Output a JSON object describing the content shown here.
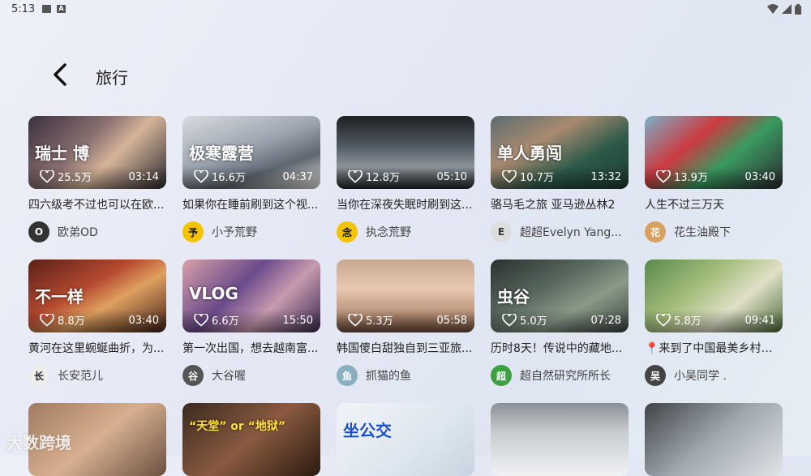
{
  "status_bar": {
    "time": "5:13"
  },
  "header": {
    "title": "旅行"
  },
  "videos": [
    {
      "likes": "25.5万",
      "duration": "03:14",
      "title": "四六级考不过也可以在欧...",
      "author": "欧弟OD",
      "overlay": "瑞士 博",
      "art": "linear-gradient(135deg,#3a3040 0%,#8a7070 40%,#d6b59a 60%,#2c2a30 100%)",
      "avatar_bg": "#333",
      "avatar_fg": "#fff",
      "avatar_text": "O"
    },
    {
      "likes": "16.6万",
      "duration": "04:37",
      "title": "如果你在睡前刷到这个视...",
      "author": "小予荒野",
      "overlay": "极寒露营",
      "art": "linear-gradient(160deg,#d8dbe0 0%,#9aa3ad 45%,#5e6670 70%,#e8e6e0 100%)",
      "avatar_bg": "#f5c400",
      "avatar_fg": "#111",
      "avatar_text": "予"
    },
    {
      "likes": "12.8万",
      "duration": "05:10",
      "title": "当你在深夜失眠时刷到这...",
      "author": "执念荒野",
      "overlay": "",
      "art": "linear-gradient(180deg,#1d2024 0%,#4f5860 40%,#8d969c 70%,#24282c 100%)",
      "avatar_bg": "#f5c400",
      "avatar_fg": "#111",
      "avatar_text": "念"
    },
    {
      "likes": "10.7万",
      "duration": "13:32",
      "title": "骆马毛之旅 亚马逊丛林2",
      "author": "超超Evelyn Yang...",
      "overlay": "单人勇闯",
      "art": "linear-gradient(150deg,#5b6c70 0%,#a88a70 35%,#2c5a48 65%,#1e3a2e 100%)",
      "avatar_bg": "#ddd",
      "avatar_fg": "#333",
      "avatar_text": "E"
    },
    {
      "likes": "13.9万",
      "duration": "03:40",
      "title": "人生不过三万天",
      "author": "花生油殿下",
      "overlay": "",
      "art": "linear-gradient(140deg,#7ab0c8 0%,#cc3a40 35%,#3a9a60 60%,#2a2a30 100%)",
      "avatar_bg": "#d9a060",
      "avatar_fg": "#fff",
      "avatar_text": "花"
    },
    {
      "likes": "8.8万",
      "duration": "03:40",
      "title": "黄河在这里蜿蜒曲折，为...",
      "author": "长安范儿",
      "overlay": "不一样",
      "art": "linear-gradient(150deg,#5a2018 0%,#b54a30 40%,#e0a060 60%,#402018 100%)",
      "avatar_bg": "#eee",
      "avatar_fg": "#222",
      "avatar_text": "长"
    },
    {
      "likes": "6.6万",
      "duration": "15:50",
      "title": "第一次出国，想去越南富...",
      "author": "大谷喔",
      "overlay": "VLOG",
      "art": "linear-gradient(135deg,#d8a0a8 0%,#6a4a8a 40%,#c89ab0 65%,#3a2a50 100%)",
      "avatar_bg": "#555",
      "avatar_fg": "#fff",
      "avatar_text": "谷"
    },
    {
      "likes": "5.3万",
      "duration": "05:58",
      "title": "韩国傻白甜独自到三亚旅...",
      "author": "抓猫的鱼",
      "overlay": "",
      "art": "linear-gradient(180deg,#c8a890 0%,#e8c8b0 40%,#b89078 75%,#6a4a3a 100%)",
      "avatar_bg": "#8ab0c0",
      "avatar_fg": "#fff",
      "avatar_text": "鱼"
    },
    {
      "likes": "5.0万",
      "duration": "07:28",
      "title": "历时8天！传说中的藏地...",
      "author": "超自然研究所所长",
      "overlay": "虫谷",
      "art": "linear-gradient(150deg,#2a3030 0%,#5a6a60 40%,#8a9a88 65%,#3a4440 100%)",
      "avatar_bg": "#3aa040",
      "avatar_fg": "#fff",
      "avatar_text": "超"
    },
    {
      "likes": "5.8万",
      "duration": "09:41",
      "title": "📍来到了中国最美乡村—...",
      "author": "小吴同学 .",
      "overlay": "",
      "art": "linear-gradient(140deg,#5a8a4a 0%,#a8c080 40%,#e0e0c8 65%,#4a6a3a 100%)",
      "avatar_bg": "#444",
      "avatar_fg": "#fff",
      "avatar_text": "吴"
    },
    {
      "likes": "",
      "duration": "",
      "title": "",
      "author": "",
      "overlay": "",
      "art": "linear-gradient(140deg,#a07a60 0%,#d8b090 50%,#6a5040 100%)"
    },
    {
      "likes": "",
      "duration": "",
      "title": "",
      "author": "",
      "overlay": "“天堂” or “地狱”",
      "art": "linear-gradient(140deg,#3a2a20 0%,#8a5a40 50%,#2a1a10 100%)"
    },
    {
      "likes": "",
      "duration": "",
      "title": "",
      "author": "",
      "overlay": "坐公交",
      "art": "linear-gradient(140deg,#f0f4f8 0%,#dde6ee 60%,#c8d4e0 100%)"
    },
    {
      "likes": "",
      "duration": "",
      "title": "",
      "author": "",
      "overlay": "",
      "art": "linear-gradient(180deg,#8a9098 0%,#c8ccd0 40%,#f0f2f4 100%)"
    },
    {
      "likes": "",
      "duration": "",
      "title": "",
      "author": "",
      "overlay": "",
      "art": "linear-gradient(140deg,#404448 0%,#a0a8b0 50%,#e0e4e8 100%)"
    }
  ],
  "watermark": "大数跨境"
}
